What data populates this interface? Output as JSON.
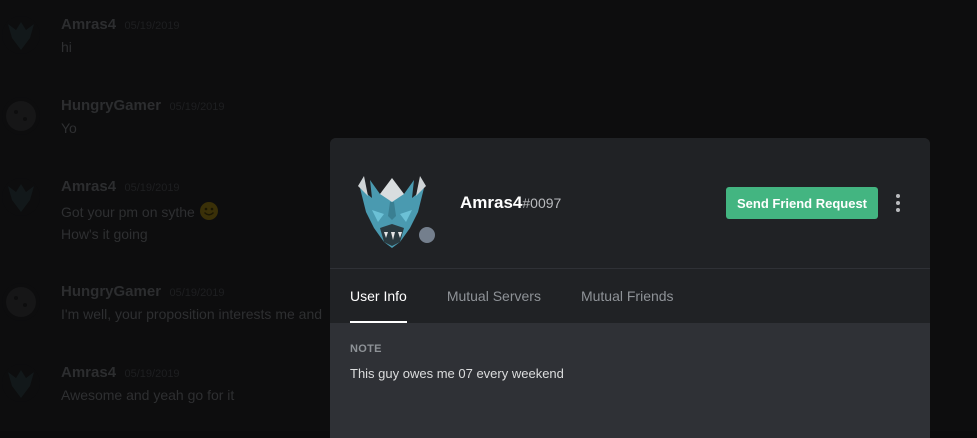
{
  "chat": {
    "messages": [
      {
        "author": "Amras4",
        "timestamp": "05/19/2019",
        "lines": [
          "hi"
        ],
        "avatar_icon": "dragon-avatar-icon"
      },
      {
        "author": "HungryGamer",
        "timestamp": "05/19/2019",
        "lines": [
          "Yo"
        ],
        "avatar_icon": "cookie-avatar-icon"
      },
      {
        "author": "Amras4",
        "timestamp": "05/19/2019",
        "lines": [
          "Got your pm on sythe",
          "How's it going"
        ],
        "emoji": "smiley-emoji",
        "avatar_icon": "dragon-avatar-icon"
      },
      {
        "author": "HungryGamer",
        "timestamp": "05/19/2019",
        "lines": [
          "I'm well, your proposition interests me and"
        ],
        "avatar_icon": "cookie-avatar-icon"
      },
      {
        "author": "Amras4",
        "timestamp": "05/19/2019",
        "lines": [
          "Awesome and yeah go for it"
        ],
        "avatar_icon": "dragon-avatar-icon"
      }
    ]
  },
  "profile": {
    "username": "Amras4",
    "discriminator": "#0097",
    "status": "offline",
    "avatar_icon": "dragon-avatar-icon",
    "send_friend_label": "Send Friend Request",
    "more_icon": "more-vertical-icon",
    "tabs": [
      {
        "label": "User Info",
        "active": true
      },
      {
        "label": "Mutual Servers",
        "active": false
      },
      {
        "label": "Mutual Friends",
        "active": false
      }
    ],
    "note_label": "NOTE",
    "note_text": "This guy owes me 07 every weekend"
  },
  "colors": {
    "accent_green": "#43b581",
    "modal_header": "#202225",
    "modal_body": "#2f3136",
    "status_offline": "#747f8d"
  }
}
